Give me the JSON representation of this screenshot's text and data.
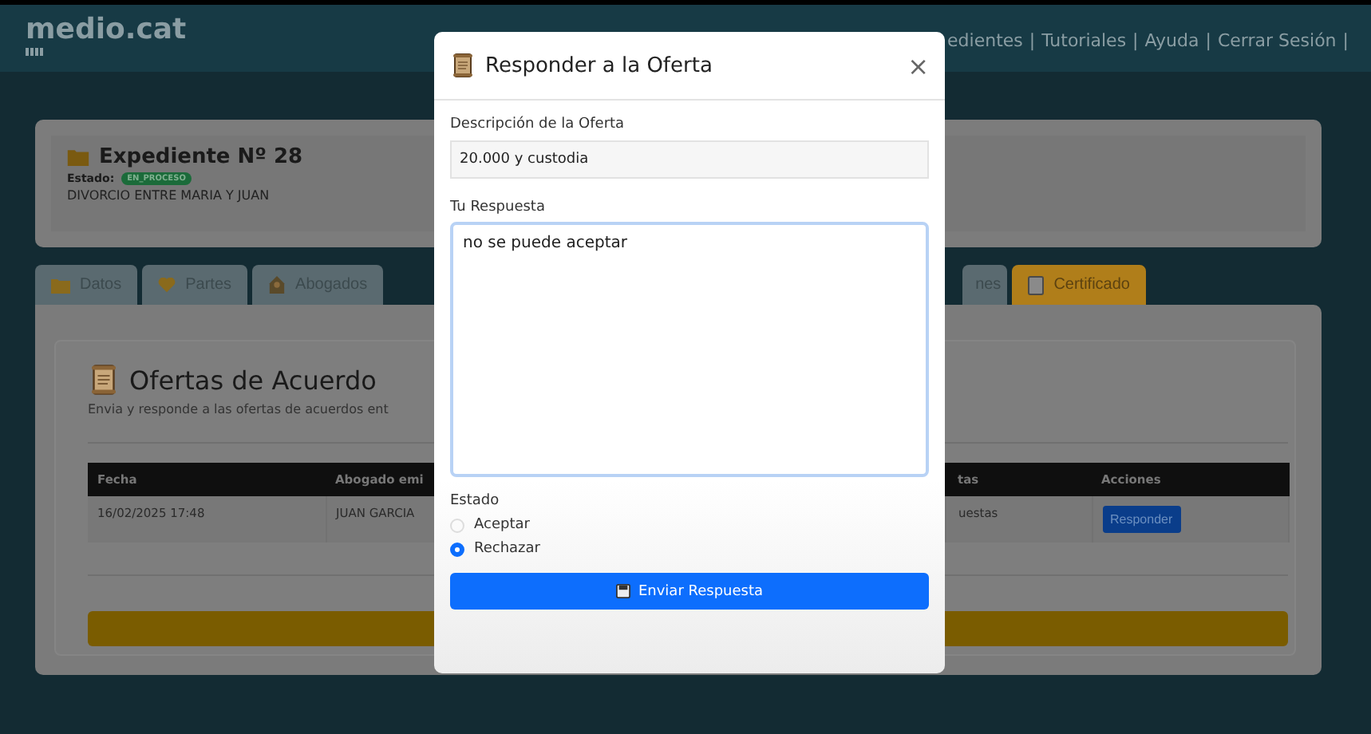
{
  "header": {
    "logo": "medio.cat",
    "nav": [
      {
        "label": "edientes",
        "separator": "|"
      },
      {
        "label": "Tutoriales",
        "separator": "|"
      },
      {
        "label": "Ayuda",
        "separator": "|"
      },
      {
        "label": "Cerrar Sesión",
        "separator": "|"
      }
    ]
  },
  "case": {
    "title": "Expediente Nº 28",
    "status_label": "Estado:",
    "status": "EN_PROCESO",
    "description": "DIVORCIO ENTRE MARIA Y JUAN"
  },
  "tabs": [
    {
      "label": "Datos",
      "highlighted": false
    },
    {
      "label": "Partes",
      "highlighted": false
    },
    {
      "label": "Abogados",
      "highlighted": false
    },
    {
      "label": "nes",
      "highlighted": false
    },
    {
      "label": "Certificado",
      "highlighted": true
    }
  ],
  "offers": {
    "title": "Ofertas de Acuerdo",
    "subtitle": "Envia y responde a las ofertas de acuerdos ent",
    "table": {
      "columns": [
        "Fecha",
        "Abogado emi",
        "tas",
        "Acciones"
      ],
      "rows": [
        {
          "cells": [
            "16/02/2025 17:48",
            "JUAN GARCIA",
            "uestas"
          ],
          "action": "Responder"
        }
      ]
    }
  },
  "dialog": {
    "title": "Responder a la Oferta",
    "close": "×",
    "description_label": "Descripción de la Oferta",
    "description": "20.000 y custodia",
    "response_label": "Tu Respuesta",
    "response": "no se puede aceptar",
    "status_label": "Estado",
    "options": [
      {
        "label": "Aceptar",
        "selected": false
      },
      {
        "label": "Rechazar",
        "selected": true
      }
    ],
    "submit": "Enviar Respuesta"
  }
}
